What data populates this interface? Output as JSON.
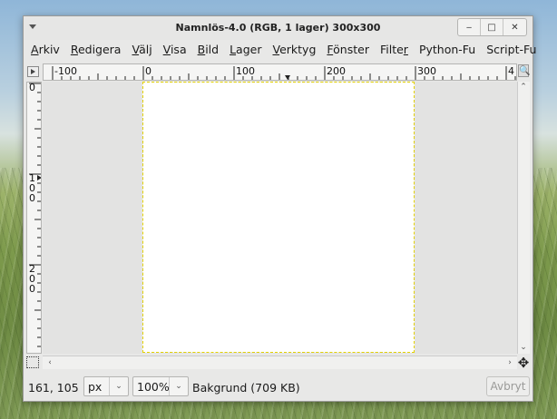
{
  "window": {
    "title": "Namnlös-4.0 (RGB, 1 lager) 300x300",
    "controls": {
      "minimize": "‒",
      "maximize": "□",
      "close": "✕"
    }
  },
  "menubar": [
    {
      "label": "Arkiv",
      "mnemonic": "A",
      "rest": "rkiv"
    },
    {
      "label": "Redigera",
      "mnemonic": "R",
      "rest": "edigera"
    },
    {
      "label": "Välj",
      "mnemonic": "V",
      "rest": "älj"
    },
    {
      "label": "Visa",
      "mnemonic": "V",
      "rest": "isa"
    },
    {
      "label": "Bild",
      "mnemonic": "B",
      "rest": "ild"
    },
    {
      "label": "Lager",
      "mnemonic": "L",
      "rest": "ager"
    },
    {
      "label": "Verktyg",
      "mnemonic": "V",
      "rest": "erktyg"
    },
    {
      "label": "Fönster",
      "mnemonic": "F",
      "rest": "önster"
    },
    {
      "label": "Filter",
      "pre": "Filte",
      "mnemonic": "r",
      "rest": ""
    },
    {
      "label": "Python-Fu",
      "mnemonic": "",
      "rest": "Python-Fu"
    },
    {
      "label": "Script-Fu",
      "mnemonic": "",
      "rest": "Script-Fu"
    }
  ],
  "rulers": {
    "horizontal_labels": [
      "-100",
      "0",
      "100",
      "200",
      "300",
      "4"
    ],
    "vertical_labels": [
      [
        "0"
      ],
      [
        "1",
        "0",
        "0"
      ],
      [
        "2",
        "0",
        "0"
      ]
    ]
  },
  "icons": {
    "window_menu": "window-menu-icon",
    "quick_mask": "quick-mask-icon",
    "navigate": "navigate-icon",
    "zoom_image": "zoom-image-icon",
    "ruler_menu": "ruler-menu-icon"
  },
  "statusbar": {
    "coordinates": "161, 105",
    "unit": "px",
    "zoom": "100%",
    "layer_info": "Bakgrund (709 KB)",
    "cancel_label": "Avbryt"
  },
  "colors": {
    "selection_dash": "#e4d200",
    "canvas_bg": "#ffffff",
    "workspace_bg": "#e3e3e2"
  }
}
